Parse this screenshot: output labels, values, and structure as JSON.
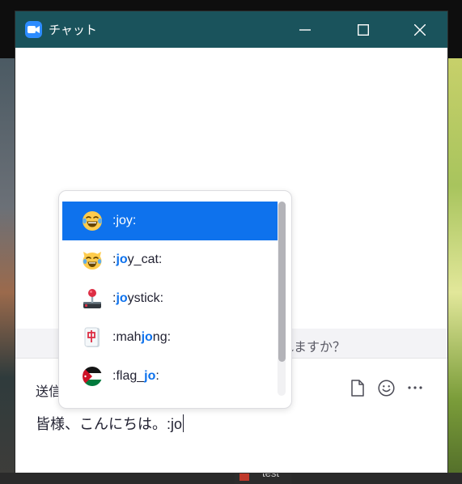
{
  "window": {
    "title": "チャット",
    "icon": "zoom-video-icon"
  },
  "notice": {
    "text": "れますか？"
  },
  "compose": {
    "send_to_label": "送信",
    "message_text": "皆様、こんにちは。:jo",
    "tools": [
      "file-icon",
      "emoji-icon",
      "more-icon"
    ]
  },
  "suggestions": [
    {
      "emoji": "joy",
      "before": ":",
      "match": "joy",
      "after": ":",
      "selected": true
    },
    {
      "emoji": "joy_cat",
      "before": ":",
      "match": "jo",
      "after": "y_cat:",
      "selected": false
    },
    {
      "emoji": "joystick",
      "before": ":",
      "match": "jo",
      "after": "ystick:",
      "selected": false
    },
    {
      "emoji": "mahjong",
      "before": ":mah",
      "match": "jo",
      "after": "ng:",
      "selected": false
    },
    {
      "emoji": "flag_jo",
      "before": ":flag_",
      "match": "jo",
      "after": ":",
      "selected": false
    }
  ],
  "taskbar": {
    "item_label": "test"
  },
  "colors": {
    "titlebar": "#1a535c",
    "accent": "#0e72ed"
  }
}
